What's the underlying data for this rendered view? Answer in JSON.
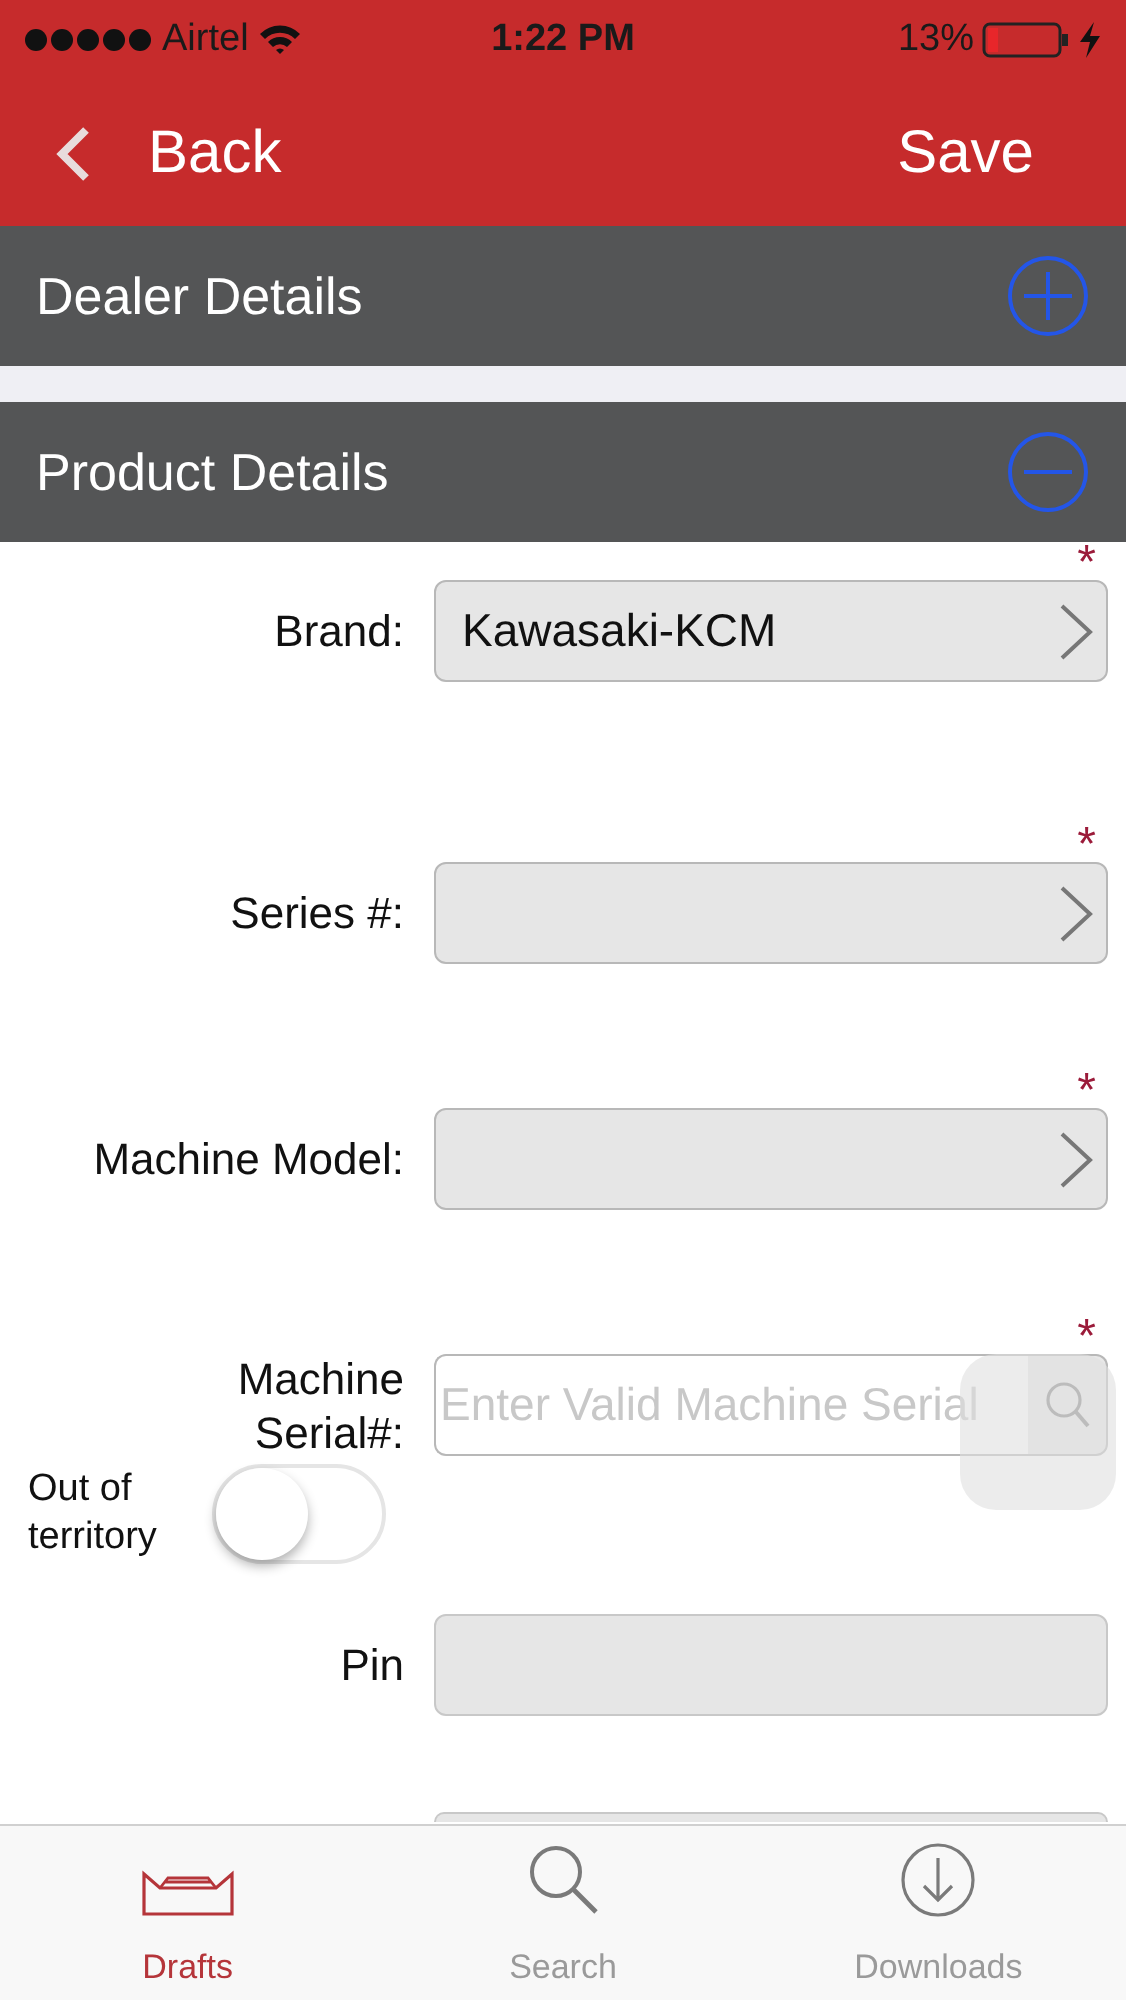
{
  "status_bar": {
    "carrier": "Airtel",
    "time": "1:22 PM",
    "battery": "13%"
  },
  "nav": {
    "back": "Back",
    "action": "Save"
  },
  "sections": [
    {
      "title": "Dealer Details",
      "expanded": false
    },
    {
      "title": "Product Details",
      "expanded": true
    }
  ],
  "fields": [
    {
      "kind": "select",
      "label": "Brand:",
      "value": "Kawasaki-KCM",
      "required_mark": "*"
    },
    {
      "kind": "select",
      "label": "Series #:",
      "required_mark": "*"
    },
    {
      "kind": "select",
      "label": "Machine Model:",
      "required_mark": "*"
    },
    {
      "kind": "search",
      "label": "Machine Serial#:",
      "placeholder": "Enter Valid Machine Serial",
      "required_mark": "*"
    },
    {
      "kind": "toggle",
      "label": "Out of territory",
      "on": false
    },
    {
      "kind": "text",
      "label": "Pin"
    },
    {
      "kind": "partial"
    }
  ],
  "tabs": [
    {
      "label": "Drafts",
      "selected": true
    },
    {
      "label": "Search",
      "selected": false
    },
    {
      "label": "Downloads",
      "selected": false
    }
  ]
}
